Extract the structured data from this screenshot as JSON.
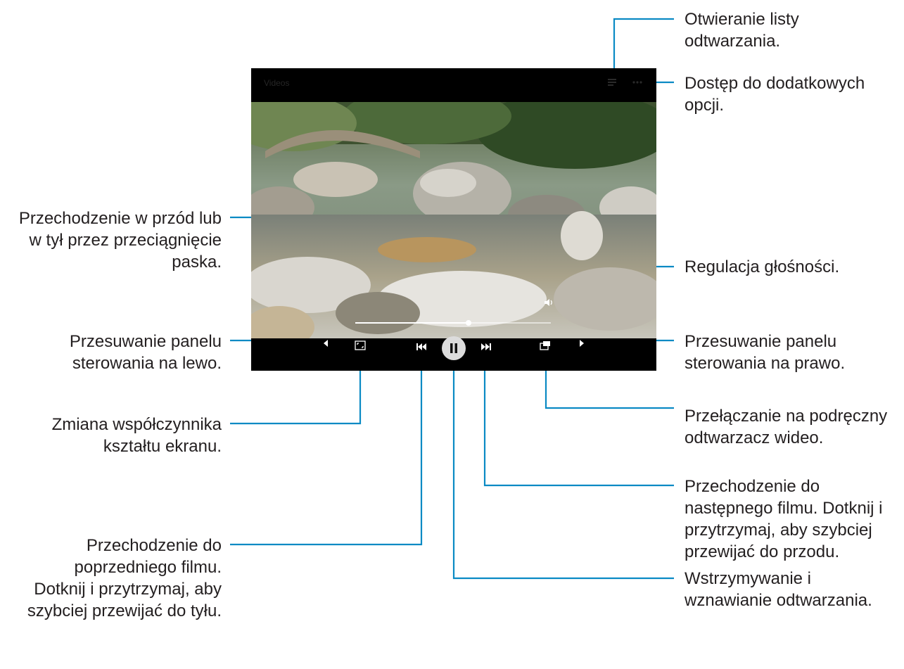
{
  "screen": {
    "title": "Videos",
    "progress_fraction": 0.58
  },
  "icons": {
    "playlist": "playlist-icon",
    "more": "more-options-icon",
    "volume": "volume-icon",
    "ratio": "aspect-ratio-icon",
    "previous": "previous-icon",
    "pause": "pause-icon",
    "next": "next-icon",
    "popup": "popup-player-icon",
    "panel_left": "arrow-left-icon",
    "panel_right": "arrow-right-icon"
  },
  "annotations": {
    "playlist": [
      "Otwieranie listy",
      "odtwarzania."
    ],
    "more_options": [
      "Dostęp do dodatkowych",
      "opcji."
    ],
    "seek": [
      "Przechodzenie w przód lub",
      "w tył przez przeciągnięcie",
      "paska."
    ],
    "volume": [
      "Regulacja głośności."
    ],
    "move_left": [
      "Przesuwanie panelu",
      "sterowania na lewo."
    ],
    "move_right": [
      "Przesuwanie panelu",
      "sterowania na prawo."
    ],
    "aspect_ratio": [
      "Zmiana współczynnika",
      "kształtu ekranu."
    ],
    "popup_player": [
      "Przełączanie na podręczny",
      "odtwarzacz wideo."
    ],
    "next_video": [
      "Przechodzenie do",
      "następnego filmu. Dotknij i",
      "przytrzymaj, aby szybciej",
      "przewijać do przodu."
    ],
    "previous_video": [
      "Przechodzenie do",
      "poprzedniego filmu.",
      "Dotknij i przytrzymaj, aby",
      "szybciej przewijać do tyłu."
    ],
    "pause_resume": [
      "Wstrzymywanie i",
      "wznawianie odtwarzania."
    ]
  },
  "colors": {
    "leader_line": "#0a8ac4",
    "screen_bg": "#000000",
    "text": "#231f20"
  }
}
